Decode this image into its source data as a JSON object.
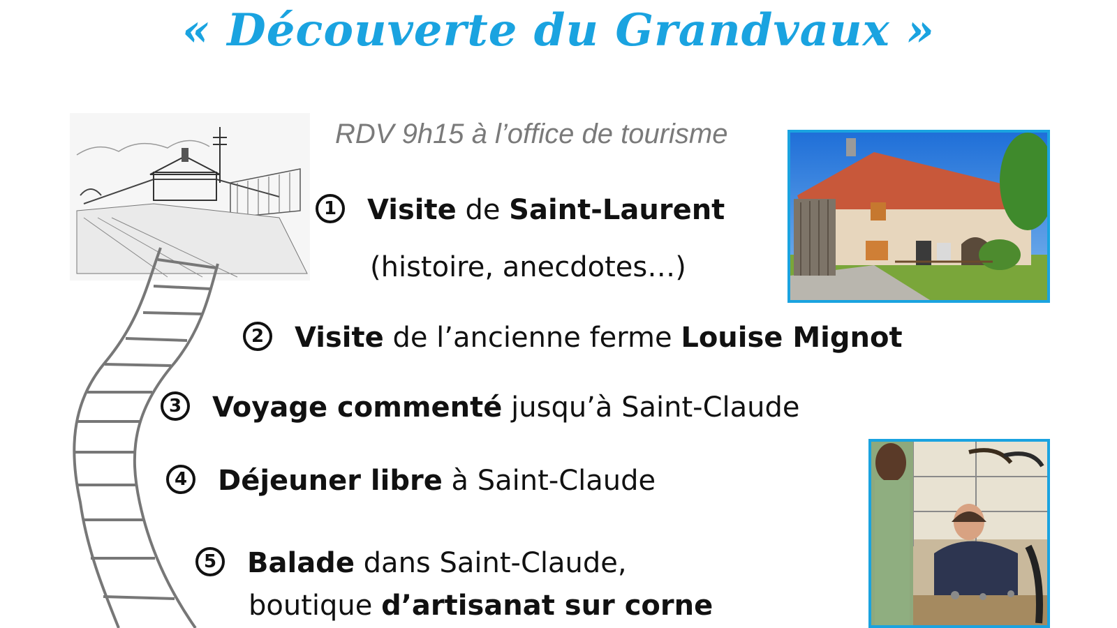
{
  "title": "« Découverte du Grandvaux »",
  "rdv": "RDV 9h15 à l’office de tourisme",
  "steps": [
    {
      "n": "1",
      "b1": "Visite",
      "t1": " de ",
      "b2": "Saint-Laurent",
      "t2": ""
    },
    {
      "n": "2",
      "b1": "Visite",
      "t1": " de l’ancienne ferme ",
      "b2": "Louise Mignot",
      "t2": ""
    },
    {
      "n": "3",
      "b1": "Voyage commenté",
      "t1": " jusqu’à Saint-Claude",
      "b2": "",
      "t2": ""
    },
    {
      "n": "4",
      "b1": "Déjeuner libre",
      "t1": " à Saint-Claude",
      "b2": "",
      "t2": ""
    },
    {
      "n": "5",
      "b1": "Balade",
      "t1": " dans Saint-Claude,",
      "b2": "",
      "t2": ""
    }
  ],
  "step1_sub": "(histoire, anecdotes…)",
  "step5_sub": {
    "t1": "boutique ",
    "b1": "d’artisanat sur corne"
  },
  "colors": {
    "accent": "#1aa3e0",
    "muted": "#7a7a7a"
  }
}
